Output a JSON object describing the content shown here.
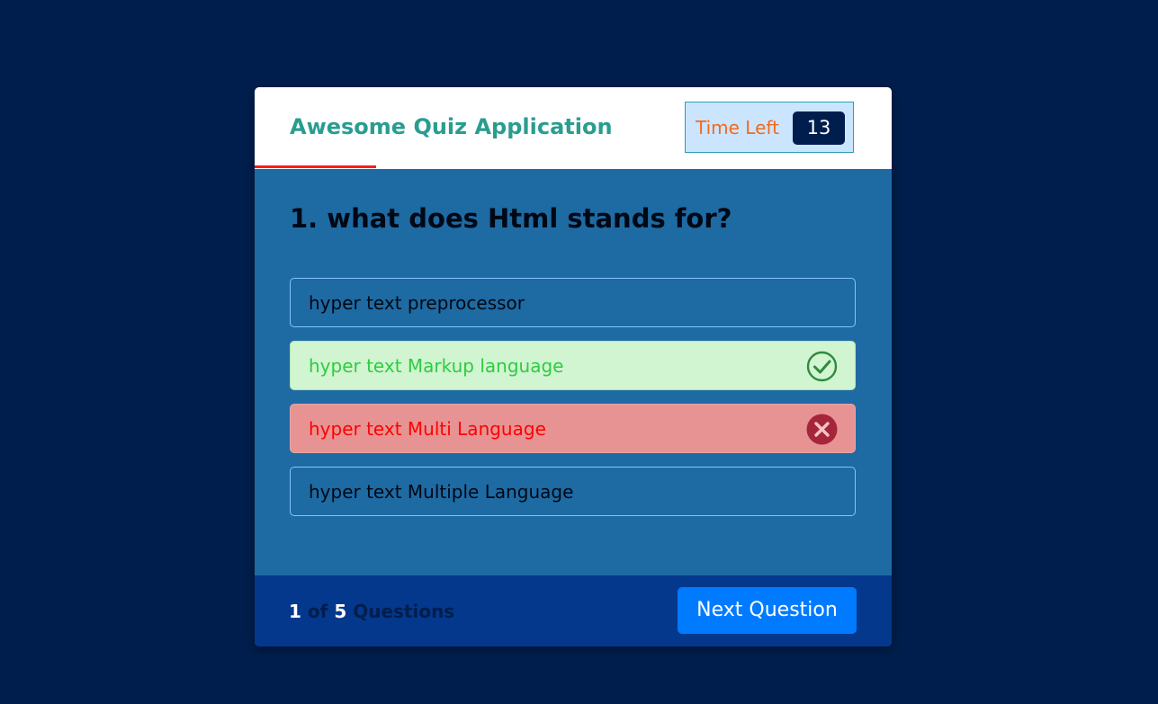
{
  "header": {
    "title": "Awesome Quiz Application",
    "timer_label": "Time Left",
    "timer_seconds": "13",
    "time_line_progress": 0.19
  },
  "question": {
    "text": "1. what does Html stands for?",
    "options": [
      {
        "label": "hyper text preprocessor",
        "state": "default"
      },
      {
        "label": "hyper text Markup language",
        "state": "correct",
        "icon": "check-circle-icon"
      },
      {
        "label": "hyper text Multi Language",
        "state": "incorrect",
        "icon": "x-circle-icon"
      },
      {
        "label": "hyper text Multiple Language",
        "state": "default"
      }
    ]
  },
  "footer": {
    "current": "1",
    "of": "of",
    "total": "5",
    "questions_label": "Questions",
    "next_label": "Next Question"
  },
  "colors": {
    "background": "#001e4d",
    "card": "#1e6aa3",
    "title": "#2a9d8f",
    "timer_label": "#f06a1e",
    "correct_bg": "#d1f4d1",
    "correct_text": "#2ecc40",
    "incorrect_bg": "#e89393",
    "incorrect_text": "#ff0000",
    "next_button": "#007bff"
  }
}
